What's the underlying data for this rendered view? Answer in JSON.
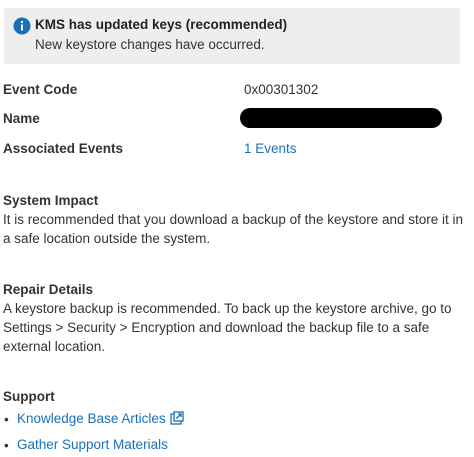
{
  "banner": {
    "icon": "info-icon",
    "title": "KMS has updated keys (recommended)",
    "subtitle": "New keystore changes have occurred."
  },
  "details": {
    "event_code_label": "Event Code",
    "event_code_value": "0x00301302",
    "name_label": "Name",
    "associated_events_label": "Associated Events",
    "associated_events_value": "1 Events"
  },
  "system_impact": {
    "title": "System Impact",
    "body": "It is recommended that you download a backup of the keystore and store it in a safe location outside the system."
  },
  "repair_details": {
    "title": "Repair Details",
    "body": "A keystore backup is recommended. To back up the keystore archive, go to Settings > Security > Encryption and download the backup file to a safe external location."
  },
  "support": {
    "title": "Support",
    "links": [
      {
        "label": "Knowledge Base Articles",
        "icon": "external-link-icon"
      },
      {
        "label": "Gather Support Materials"
      }
    ]
  },
  "colors": {
    "link": "#1a6fb9",
    "info_icon": "#1a6fb9",
    "banner_background": "#eeeeee"
  }
}
